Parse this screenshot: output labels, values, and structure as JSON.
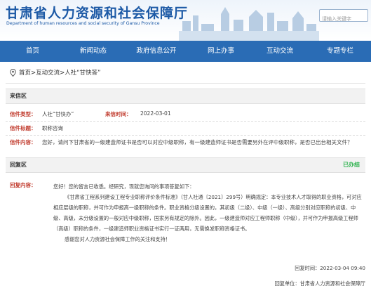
{
  "header": {
    "title": "甘肃省人力资源和社会保障厅",
    "subtitle": "Department of human resources and social security of Gansu Province",
    "search_placeholder": "请输入关键字"
  },
  "nav": {
    "items": [
      {
        "label": "首页"
      },
      {
        "label": "新闻动态"
      },
      {
        "label": "政府信息公开"
      },
      {
        "label": "网上办事"
      },
      {
        "label": "互动交流"
      },
      {
        "label": "专题专栏"
      }
    ]
  },
  "breadcrumb": {
    "icon": "location-pin-icon",
    "text": "首页>互动交流>人社“甘快答”"
  },
  "letter": {
    "section_label": "来信区",
    "type_label": "信件类型：",
    "type_value": "人社“甘快办”",
    "time_label": "来信时间：",
    "time_value": "2022-03-01",
    "title_label": "信件标题：",
    "title_value": "职称咨询",
    "content_label": "信件内容：",
    "content_value": "您好，请问下甘肃省的一级建造师证书是否可以对应中级职称，有一级建造师证书是否需要另外在评中级职称，是否已出台相关文件？"
  },
  "reply": {
    "section_label": "回复区",
    "status": "已办结",
    "content_label": "回复内容：",
    "paragraphs": [
      "您好！您的留言已收悉。经研究，现就您询问的事项答复如下：",
      "《甘肃省工程系列建设工程专业职称评价条件标准》（甘人社通〔2021〕299号）明确规定：本专业技术人才取得的职业资格，可对应相应层级的职称，并可作为申报高一级职称的条件。职业资格分级设置的，其初级（二级）、中级（一级）、高级分别对应职称的初级、中级、高级，未分级设置的一般对应中级职称，国家另有规定的除外。因此，一级建造师对应工程师职称（中级），并可作为申报高级工程师（高级）职称的条件，一级建造师职业资格证书实行一证两用，无需换发职称资格证书。",
      "感谢您对人力资源社会保障工作的关注和支持！"
    ],
    "time": "回复时间：2022-03-04 09:40",
    "unit": "回复单位：甘肃省人力资源和社会保障厅"
  },
  "colors": {
    "nav_bg": "#2a6cb5",
    "title_blue": "#1d5aa6",
    "label_red": "#c0392b",
    "status_green": "#2bb24c"
  }
}
